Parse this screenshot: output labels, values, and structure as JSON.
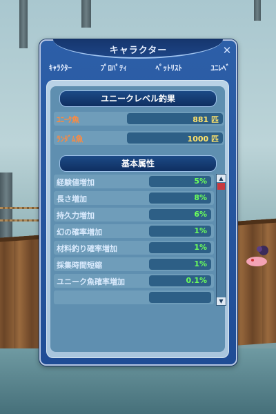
{
  "window": {
    "title": "キャラクター",
    "close_icon": "close-icon"
  },
  "tabs": [
    {
      "label": "ｷｬﾗｸﾀｰ"
    },
    {
      "label": "ﾌﾟﾛﾊﾟﾃｨ"
    },
    {
      "label": "ﾍﾟｯﾄﾘｽﾄ"
    },
    {
      "label": "ﾕﾆﾚﾍﾞ"
    }
  ],
  "fishing": {
    "header": "ユニークレベル釣果",
    "rows": [
      {
        "label": "ﾕﾆｰｸ魚",
        "value": "881 匹"
      },
      {
        "label": "ﾗﾝﾀﾞﾑ魚",
        "value": "1000 匹"
      }
    ]
  },
  "attributes": {
    "header": "基本属性",
    "rows": [
      {
        "label": "経験値増加",
        "value": "5%"
      },
      {
        "label": "長さ増加",
        "value": "8%"
      },
      {
        "label": "持久力増加",
        "value": "6%"
      },
      {
        "label": "幻の確率増加",
        "value": "1%"
      },
      {
        "label": "材料釣り確率増加",
        "value": "1%"
      },
      {
        "label": "採集時間短縮",
        "value": "1%"
      },
      {
        "label": "ユニーク魚確率増加",
        "value": "0.1%"
      },
      {
        "label": "",
        "value": ""
      }
    ]
  },
  "colors": {
    "window_bg": "#1f4c95",
    "label_orange": "#ff8a3d",
    "value_yellow": "#ffe36a",
    "value_green": "#6bff5a",
    "scroll_thumb": "#c8393e"
  }
}
